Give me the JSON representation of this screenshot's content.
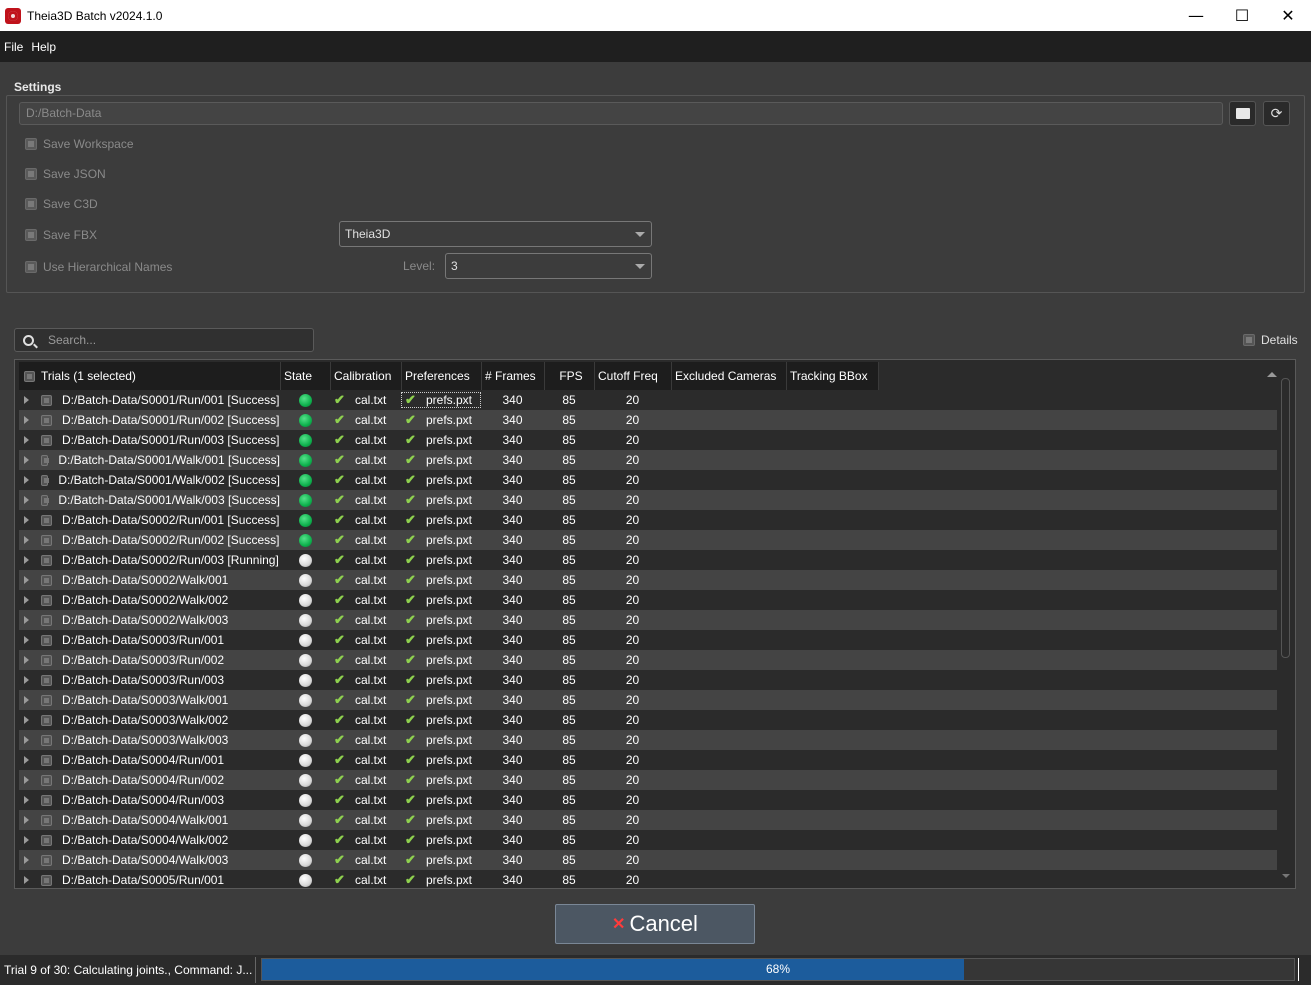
{
  "window": {
    "title": "Theia3D Batch v2024.1.0",
    "controls": {
      "minimize": "—",
      "maximize": "☐",
      "close": "✕"
    }
  },
  "menu": [
    "File",
    "Help"
  ],
  "settings": {
    "title": "Settings",
    "path_value": "D:/Batch-Data",
    "save_workspace": "Save Workspace",
    "save_json": "Save JSON",
    "save_c3d": "Save C3D",
    "save_fbx": "Save FBX",
    "use_hierarchical": "Use Hierarchical Names",
    "fbx_format": "Theia3D",
    "level_label": "Level:",
    "level_value": "3"
  },
  "search": {
    "placeholder": "Search..."
  },
  "details_label": "Details",
  "table": {
    "headers": {
      "trials": "Trials (1 selected)",
      "state": "State",
      "calibration": "Calibration",
      "preferences": "Preferences",
      "frames": "# Frames",
      "fps": "FPS",
      "cutoff": "Cutoff Freq",
      "excluded": "Excluded Cameras",
      "bbox": "Tracking BBox"
    },
    "rows": [
      {
        "trial": "D:/Batch-Data/S0001/Run/001 [Success]",
        "state": "success",
        "cal": "cal.txt",
        "pref": "prefs.pxt",
        "frames": "340",
        "fps": "85",
        "cutoff": "20"
      },
      {
        "trial": "D:/Batch-Data/S0001/Run/002 [Success]",
        "state": "success",
        "cal": "cal.txt",
        "pref": "prefs.pxt",
        "frames": "340",
        "fps": "85",
        "cutoff": "20"
      },
      {
        "trial": "D:/Batch-Data/S0001/Run/003 [Success]",
        "state": "success",
        "cal": "cal.txt",
        "pref": "prefs.pxt",
        "frames": "340",
        "fps": "85",
        "cutoff": "20"
      },
      {
        "trial": "D:/Batch-Data/S0001/Walk/001 [Success]",
        "state": "success",
        "cal": "cal.txt",
        "pref": "prefs.pxt",
        "frames": "340",
        "fps": "85",
        "cutoff": "20"
      },
      {
        "trial": "D:/Batch-Data/S0001/Walk/002 [Success]",
        "state": "success",
        "cal": "cal.txt",
        "pref": "prefs.pxt",
        "frames": "340",
        "fps": "85",
        "cutoff": "20"
      },
      {
        "trial": "D:/Batch-Data/S0001/Walk/003 [Success]",
        "state": "success",
        "cal": "cal.txt",
        "pref": "prefs.pxt",
        "frames": "340",
        "fps": "85",
        "cutoff": "20"
      },
      {
        "trial": "D:/Batch-Data/S0002/Run/001 [Success]",
        "state": "success",
        "cal": "cal.txt",
        "pref": "prefs.pxt",
        "frames": "340",
        "fps": "85",
        "cutoff": "20"
      },
      {
        "trial": "D:/Batch-Data/S0002/Run/002 [Success]",
        "state": "success",
        "cal": "cal.txt",
        "pref": "prefs.pxt",
        "frames": "340",
        "fps": "85",
        "cutoff": "20"
      },
      {
        "trial": "D:/Batch-Data/S0002/Run/003 [Running]",
        "state": "pending",
        "cal": "cal.txt",
        "pref": "prefs.pxt",
        "frames": "340",
        "fps": "85",
        "cutoff": "20"
      },
      {
        "trial": "D:/Batch-Data/S0002/Walk/001",
        "state": "pending",
        "cal": "cal.txt",
        "pref": "prefs.pxt",
        "frames": "340",
        "fps": "85",
        "cutoff": "20"
      },
      {
        "trial": "D:/Batch-Data/S0002/Walk/002",
        "state": "pending",
        "cal": "cal.txt",
        "pref": "prefs.pxt",
        "frames": "340",
        "fps": "85",
        "cutoff": "20"
      },
      {
        "trial": "D:/Batch-Data/S0002/Walk/003",
        "state": "pending",
        "cal": "cal.txt",
        "pref": "prefs.pxt",
        "frames": "340",
        "fps": "85",
        "cutoff": "20"
      },
      {
        "trial": "D:/Batch-Data/S0003/Run/001",
        "state": "pending",
        "cal": "cal.txt",
        "pref": "prefs.pxt",
        "frames": "340",
        "fps": "85",
        "cutoff": "20"
      },
      {
        "trial": "D:/Batch-Data/S0003/Run/002",
        "state": "pending",
        "cal": "cal.txt",
        "pref": "prefs.pxt",
        "frames": "340",
        "fps": "85",
        "cutoff": "20"
      },
      {
        "trial": "D:/Batch-Data/S0003/Run/003",
        "state": "pending",
        "cal": "cal.txt",
        "pref": "prefs.pxt",
        "frames": "340",
        "fps": "85",
        "cutoff": "20"
      },
      {
        "trial": "D:/Batch-Data/S0003/Walk/001",
        "state": "pending",
        "cal": "cal.txt",
        "pref": "prefs.pxt",
        "frames": "340",
        "fps": "85",
        "cutoff": "20"
      },
      {
        "trial": "D:/Batch-Data/S0003/Walk/002",
        "state": "pending",
        "cal": "cal.txt",
        "pref": "prefs.pxt",
        "frames": "340",
        "fps": "85",
        "cutoff": "20"
      },
      {
        "trial": "D:/Batch-Data/S0003/Walk/003",
        "state": "pending",
        "cal": "cal.txt",
        "pref": "prefs.pxt",
        "frames": "340",
        "fps": "85",
        "cutoff": "20"
      },
      {
        "trial": "D:/Batch-Data/S0004/Run/001",
        "state": "pending",
        "cal": "cal.txt",
        "pref": "prefs.pxt",
        "frames": "340",
        "fps": "85",
        "cutoff": "20"
      },
      {
        "trial": "D:/Batch-Data/S0004/Run/002",
        "state": "pending",
        "cal": "cal.txt",
        "pref": "prefs.pxt",
        "frames": "340",
        "fps": "85",
        "cutoff": "20"
      },
      {
        "trial": "D:/Batch-Data/S0004/Run/003",
        "state": "pending",
        "cal": "cal.txt",
        "pref": "prefs.pxt",
        "frames": "340",
        "fps": "85",
        "cutoff": "20"
      },
      {
        "trial": "D:/Batch-Data/S0004/Walk/001",
        "state": "pending",
        "cal": "cal.txt",
        "pref": "prefs.pxt",
        "frames": "340",
        "fps": "85",
        "cutoff": "20"
      },
      {
        "trial": "D:/Batch-Data/S0004/Walk/002",
        "state": "pending",
        "cal": "cal.txt",
        "pref": "prefs.pxt",
        "frames": "340",
        "fps": "85",
        "cutoff": "20"
      },
      {
        "trial": "D:/Batch-Data/S0004/Walk/003",
        "state": "pending",
        "cal": "cal.txt",
        "pref": "prefs.pxt",
        "frames": "340",
        "fps": "85",
        "cutoff": "20"
      },
      {
        "trial": "D:/Batch-Data/S0005/Run/001",
        "state": "pending",
        "cal": "cal.txt",
        "pref": "prefs.pxt",
        "frames": "340",
        "fps": "85",
        "cutoff": "20"
      }
    ]
  },
  "cancel_label": "Cancel",
  "status": {
    "text": "Trial 9 of 30: Calculating joints., Command: J...",
    "progress_label": "68%",
    "progress_fraction": 0.68
  },
  "colors": {
    "success": "#0eb14d",
    "progress": "#1c5c9c",
    "check": "#8fd14f"
  }
}
